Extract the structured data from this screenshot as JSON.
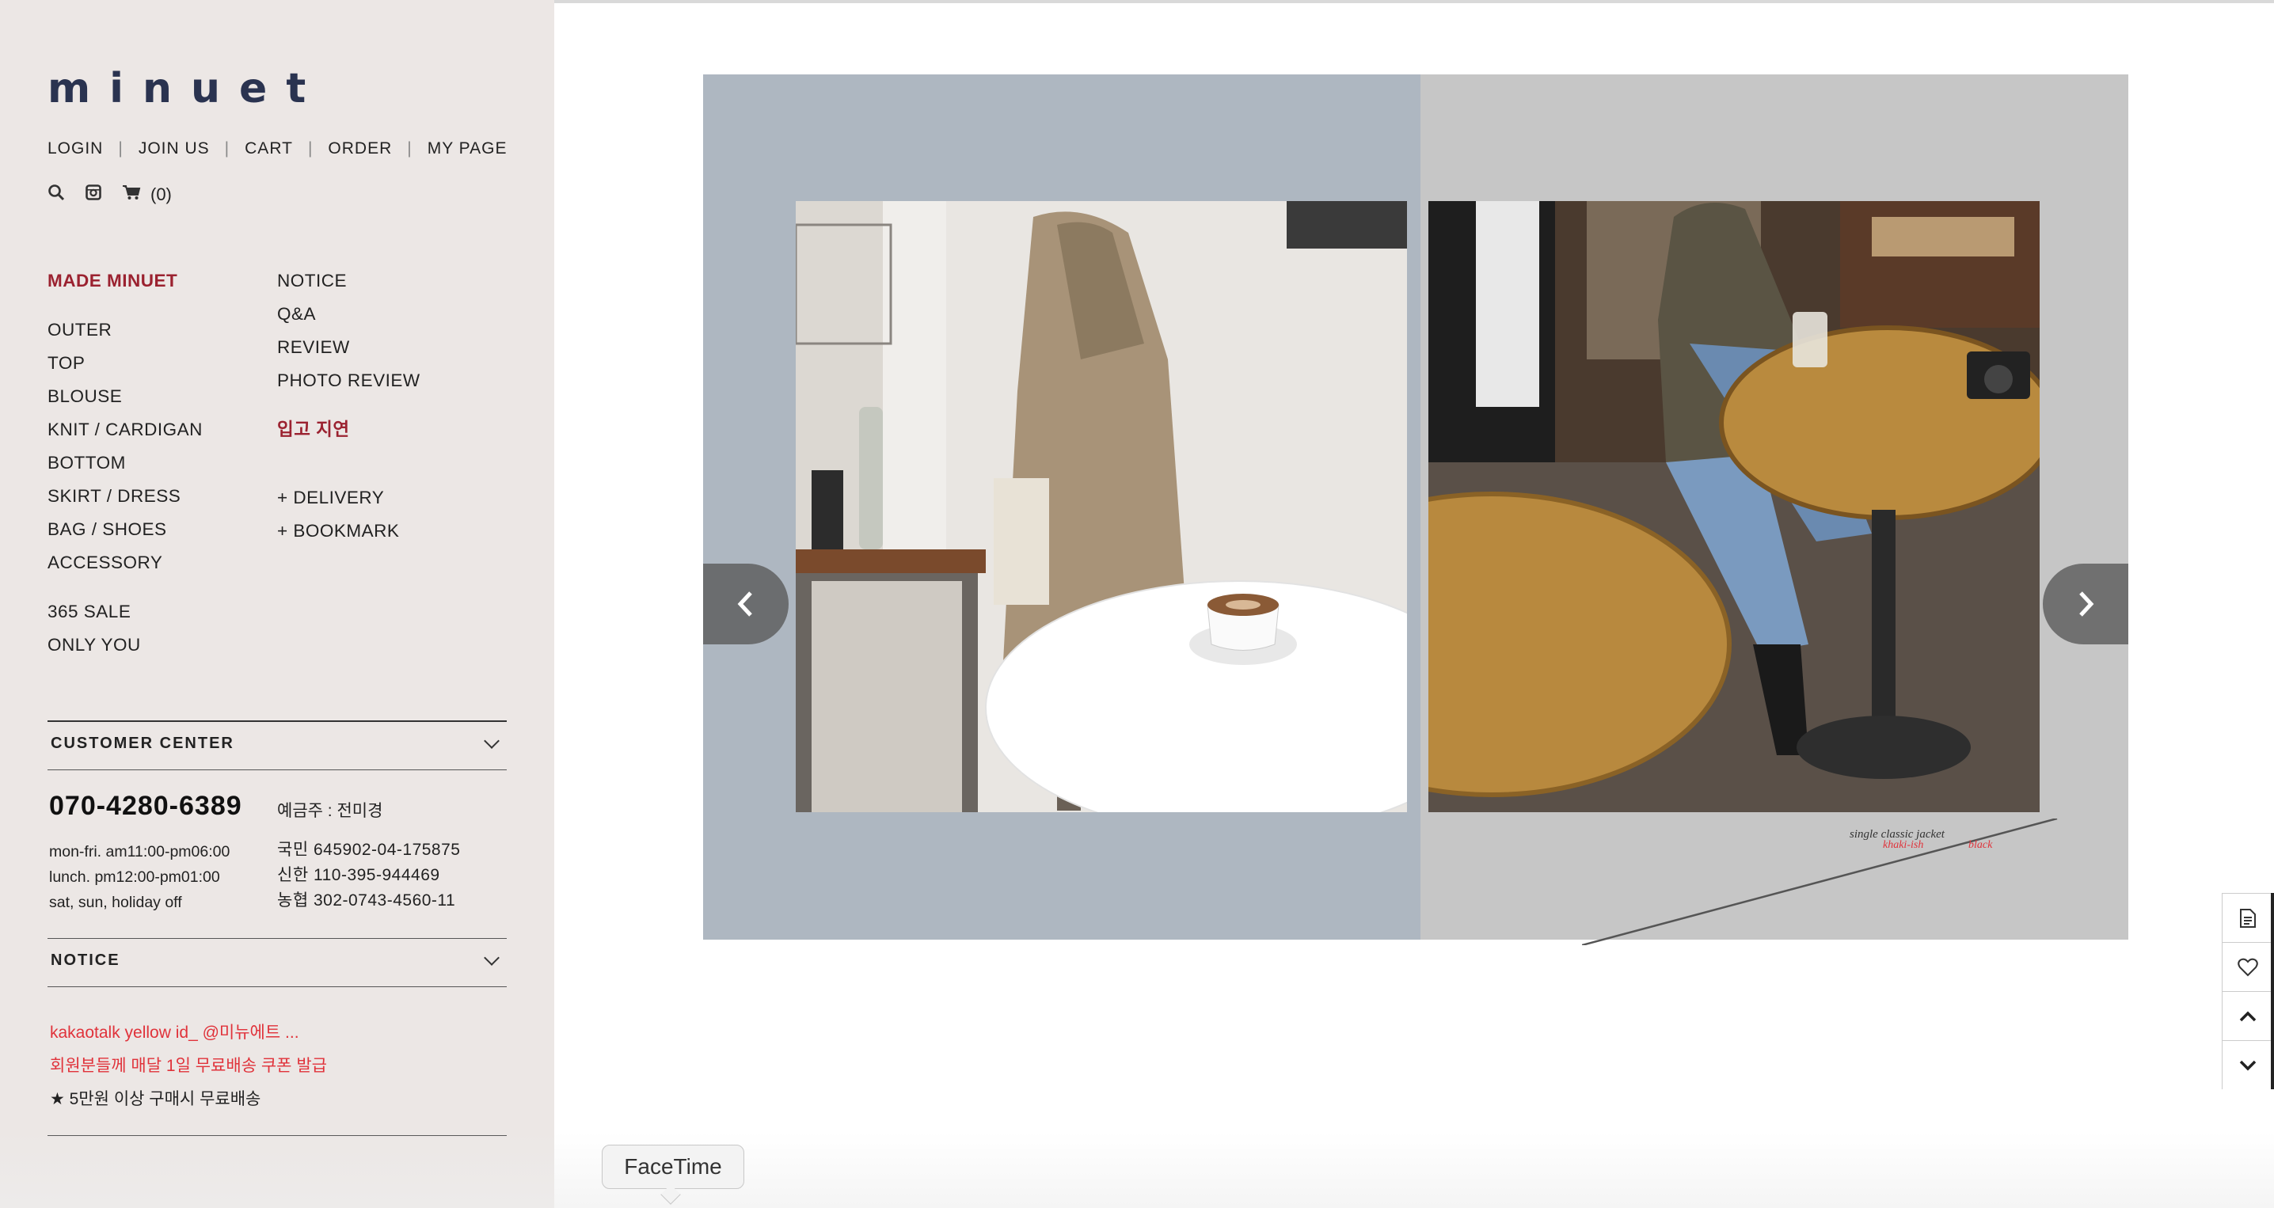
{
  "brand": {
    "logo": "minuet"
  },
  "top_nav": [
    "LOGIN",
    "JOIN US",
    "CART",
    "ORDER",
    "MY PAGE"
  ],
  "icons": {
    "search": "search-icon",
    "instagram": "instagram-icon",
    "cart": "cart-icon",
    "cart_count": "(0)"
  },
  "menu_left": {
    "highlight": "MADE MINUET",
    "categories": [
      "OUTER",
      "TOP",
      "BLOUSE",
      "KNIT / CARDIGAN",
      "BOTTOM",
      "SKIRT / DRESS",
      "BAG / SHOES",
      "ACCESSORY"
    ],
    "extra": [
      "365 SALE",
      "ONLY YOU"
    ]
  },
  "menu_right": {
    "board": [
      "NOTICE",
      "Q&A",
      "REVIEW",
      "PHOTO REVIEW"
    ],
    "highlight": "입고 지연",
    "links": [
      "+ DELIVERY",
      "+ BOOKMARK"
    ]
  },
  "customer_center": {
    "title": "CUSTOMER CENTER",
    "phone": "070-4280-6389",
    "holder": "예금주 : 전미경",
    "hours": [
      "mon-fri. am11:00-pm06:00",
      "lunch. pm12:00-pm01:00",
      "sat, sun, holiday off"
    ],
    "accounts": [
      "국민 645902-04-175875",
      "신한 110-395-944469",
      "농협 302-0743-4560-11"
    ]
  },
  "notice": {
    "title": "NOTICE",
    "items": [
      {
        "text": "kakaotalk yellow id_ @미뉴에트 ...",
        "color": "#e0323a"
      },
      {
        "text": "회원분들께 매달 1일 무료배송 쿠폰 발급",
        "color": "#e0323a"
      },
      {
        "text": "★ 5만원 이상 구매시 무료배송",
        "color": "#222222"
      }
    ]
  },
  "slider": {
    "caption": "single classic jacket",
    "caption_colors": [
      "khaki-ish",
      "black"
    ],
    "prev_icon": "chevron-left-icon",
    "next_icon": "chevron-right-icon"
  },
  "quickbar": [
    "document-icon",
    "heart-icon",
    "chevron-up-icon",
    "chevron-down-icon"
  ],
  "dock_tooltip": "FaceTime",
  "colors": {
    "accent": "#9b2230",
    "notice_red": "#e0323a",
    "sidebar_bg": "#ece7e5",
    "logo": "#2a3350"
  }
}
